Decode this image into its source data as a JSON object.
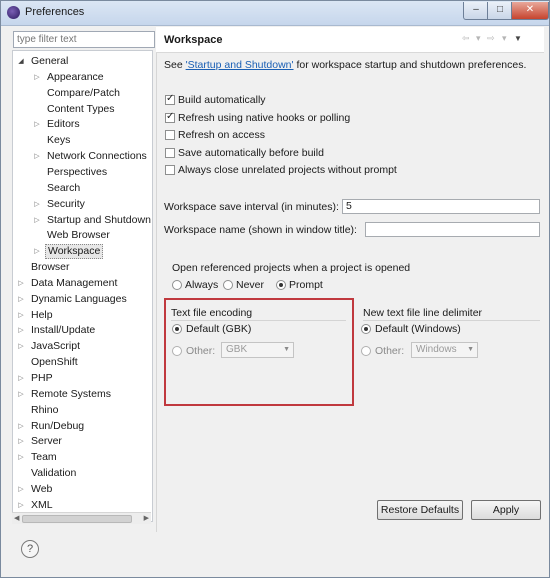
{
  "window": {
    "title": "Preferences"
  },
  "filter": {
    "placeholder": "type filter text"
  },
  "tree": [
    {
      "label": "General",
      "level": 0,
      "state": "expanded"
    },
    {
      "label": "Appearance",
      "level": 1,
      "state": "collapsed"
    },
    {
      "label": "Compare/Patch",
      "level": 1,
      "state": "leaf"
    },
    {
      "label": "Content Types",
      "level": 1,
      "state": "leaf"
    },
    {
      "label": "Editors",
      "level": 1,
      "state": "collapsed"
    },
    {
      "label": "Keys",
      "level": 1,
      "state": "leaf"
    },
    {
      "label": "Network Connections",
      "level": 1,
      "state": "collapsed"
    },
    {
      "label": "Perspectives",
      "level": 1,
      "state": "leaf"
    },
    {
      "label": "Search",
      "level": 1,
      "state": "leaf"
    },
    {
      "label": "Security",
      "level": 1,
      "state": "collapsed"
    },
    {
      "label": "Startup and Shutdown",
      "level": 1,
      "state": "collapsed"
    },
    {
      "label": "Web Browser",
      "level": 1,
      "state": "leaf"
    },
    {
      "label": "Workspace",
      "level": 1,
      "state": "collapsed",
      "selected": true
    },
    {
      "label": "Browser",
      "level": 0,
      "state": "leaf"
    },
    {
      "label": "Data Management",
      "level": 0,
      "state": "collapsed"
    },
    {
      "label": "Dynamic Languages",
      "level": 0,
      "state": "collapsed"
    },
    {
      "label": "Help",
      "level": 0,
      "state": "collapsed"
    },
    {
      "label": "Install/Update",
      "level": 0,
      "state": "collapsed"
    },
    {
      "label": "JavaScript",
      "level": 0,
      "state": "collapsed"
    },
    {
      "label": "OpenShift",
      "level": 0,
      "state": "leaf"
    },
    {
      "label": "PHP",
      "level": 0,
      "state": "collapsed"
    },
    {
      "label": "Remote Systems",
      "level": 0,
      "state": "collapsed"
    },
    {
      "label": "Rhino",
      "level": 0,
      "state": "leaf"
    },
    {
      "label": "Run/Debug",
      "level": 0,
      "state": "collapsed"
    },
    {
      "label": "Server",
      "level": 0,
      "state": "collapsed"
    },
    {
      "label": "Team",
      "level": 0,
      "state": "collapsed"
    },
    {
      "label": "Validation",
      "level": 0,
      "state": "leaf"
    },
    {
      "label": "Web",
      "level": 0,
      "state": "collapsed"
    },
    {
      "label": "XML",
      "level": 0,
      "state": "collapsed"
    }
  ],
  "page": {
    "title": "Workspace",
    "see_prefix": "See ",
    "see_link": "'Startup and Shutdown'",
    "see_suffix": " for workspace startup and shutdown preferences.",
    "checkboxes": [
      {
        "label": "Build automatically",
        "checked": true
      },
      {
        "label": "Refresh using native hooks or polling",
        "checked": true
      },
      {
        "label": "Refresh on access",
        "checked": false
      },
      {
        "label": "Save automatically before build",
        "checked": false
      },
      {
        "label": "Always close unrelated projects without prompt",
        "checked": false
      }
    ],
    "save_interval_label": "Workspace save interval (in minutes):",
    "save_interval_value": "5",
    "workspace_name_label": "Workspace name (shown in window title):",
    "workspace_name_value": "",
    "open_ref_label": "Open referenced projects when a project is opened",
    "open_ref_options": [
      {
        "label": "Always",
        "selected": false
      },
      {
        "label": "Never",
        "selected": false
      },
      {
        "label": "Prompt",
        "selected": true
      }
    ],
    "encoding": {
      "title": "Text file encoding",
      "default_label": "Default (GBK)",
      "other_label": "Other:",
      "other_value": "GBK",
      "selected": "default"
    },
    "delimiter": {
      "title": "New text file line delimiter",
      "default_label": "Default (Windows)",
      "other_label": "Other:",
      "other_value": "Windows",
      "selected": "default"
    },
    "restore_defaults": "Restore Defaults",
    "apply": "Apply"
  },
  "colors": {
    "highlight_box": "#c0393e",
    "link": "#1a5fb4"
  }
}
